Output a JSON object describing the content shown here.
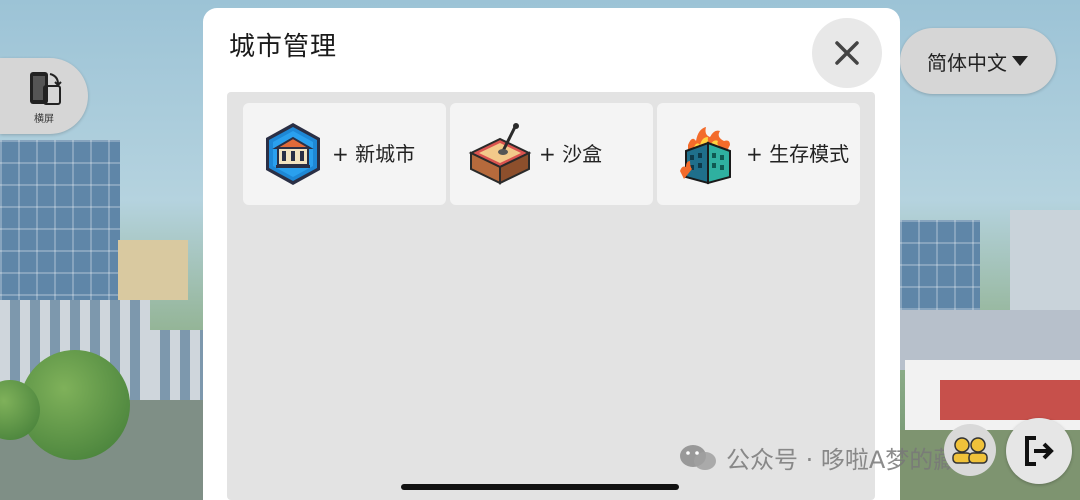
{
  "side": {
    "rotate_label": "横屏",
    "language_label": "简体中文"
  },
  "modal": {
    "title": "城市管理",
    "options": [
      {
        "label": "+ 新城市",
        "icon": "city-hall-badge-icon"
      },
      {
        "label": "+ 沙盒",
        "icon": "sandbox-icon"
      },
      {
        "label": "+ 生存模式",
        "icon": "burning-building-icon"
      }
    ]
  },
  "watermark": {
    "text": "公众号 · 哆啦A梦的藏店"
  },
  "colors": {
    "panel": "#e3e3e3",
    "card": "#f4f4f4",
    "button_bg": "#d6d6d6"
  }
}
